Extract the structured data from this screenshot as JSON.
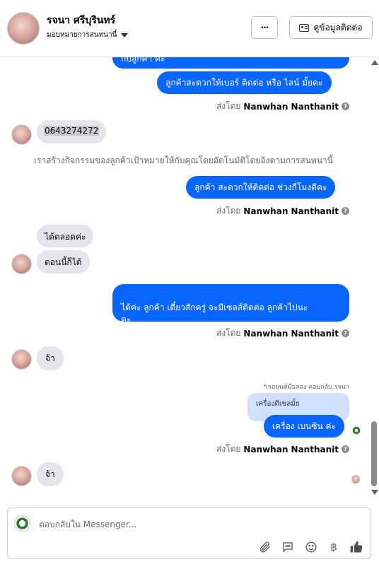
{
  "header": {
    "contact_name": "รจนา ศรีบุรินทร์",
    "assign_label": "มอบหมายการสนทนานี้",
    "contact_info_label": "ดูข้อมูลติดต่อ",
    "more_label": "···"
  },
  "thread": {
    "messages": [
      {
        "text": "กับลูกค้า ค่ะ"
      },
      {
        "text": "ลูกค้าสะดวกให้เบอร์ ติดต่อ หรือ ไลน์ มั้ยคะ"
      },
      {
        "text": "0643274272"
      },
      {
        "text": "เราสร้างกิจกรรมของลูกค้าเป้าหมายให้กับคุณโดยอัตโนมัติโดยอิงตามการสนทนานี้"
      },
      {
        "text": "ลูกค้า สะดวกให้ติดต่อ ช่วงกี่โมงดีคะ"
      },
      {
        "text": "ได้ตลอดค่ะ"
      },
      {
        "text": "ตอนนี้ก็ได้"
      },
      {
        "text": "ได้ค่ะ ลูกค้า เดี๋ยวสักครู่ จะมีเซลส์ติดต่อ ลูกค้าไปนะ\nคะ"
      },
      {
        "text": "จ้า"
      },
      {
        "text": "รถยนต์มือสอง ตอบกลับ รจนา"
      },
      {
        "text": "เครื่องดีเซลมั้ย"
      },
      {
        "text": "เครื่อง เบนซิน ค่ะ"
      },
      {
        "text": "จ้า"
      }
    ],
    "sent_by_prefix": "ส่งโดย",
    "sent_by_name": "Nanwhan Nanthanit"
  },
  "composer": {
    "placeholder": "ตอบกลับใน Messenger...",
    "tools": [
      "paperclip-icon",
      "saved-reply-icon",
      "emoji-icon",
      "baht-icon",
      "thumbs-up-icon"
    ]
  },
  "colors": {
    "outgoing_bubble": "#0866ff",
    "incoming_bubble": "#e4e6eb",
    "quoted_bubble": "#cfe1fd"
  }
}
